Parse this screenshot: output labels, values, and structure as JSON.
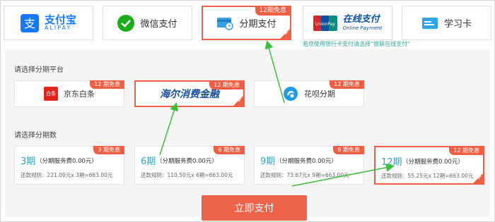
{
  "pay_methods": [
    {
      "id": "alipay",
      "label": "支付宝",
      "sublabel": "ALIPAY",
      "selected": false
    },
    {
      "id": "wechat",
      "label": "微信支付",
      "selected": false
    },
    {
      "id": "installment",
      "label": "分期支付",
      "badge": "12期免息",
      "selected": true
    },
    {
      "id": "unionpay",
      "label": "在线支付",
      "sublabel": "Online Payment",
      "brand": "UnionPay 银联",
      "selected": false
    },
    {
      "id": "studycard",
      "label": "学习卡",
      "selected": false
    }
  ],
  "unionpay_tip": "若您使用银行卡支付请选择“银联在线支付”",
  "platform_section_label": "请选择分期平台",
  "platforms": [
    {
      "id": "jd",
      "label": "京东白条",
      "logo_text": "白条",
      "badge": "12 期免息",
      "selected": false
    },
    {
      "id": "haier",
      "label": "海尔消费金融",
      "badge": "12 期免息",
      "selected": true
    },
    {
      "id": "huabei",
      "label": "花呗分期",
      "badge": "12 期免息",
      "selected": false
    }
  ],
  "installment_section_label": "请选择分期数",
  "installments": [
    {
      "num": "3期",
      "fee": "（分期服务费0.00元）",
      "rule": "还款规则：221.00元x 3期=663.00元",
      "badge": "3 期免息",
      "selected": false
    },
    {
      "num": "6期",
      "fee": "（分期服务费0.00元）",
      "rule": "还款规则：110.50元x 6期=663.00元",
      "badge": "6 期免息",
      "selected": false
    },
    {
      "num": "9期",
      "fee": "（分期服务费0.00元）",
      "rule": "还款规则：73.67元x 9期=663.00元",
      "badge": "9 期免息",
      "selected": false
    },
    {
      "num": "12期",
      "fee": "（分期服务费0.00元）",
      "rule": "还款规则：55.25元x 12期=663.00元",
      "badge": "12 期免息",
      "selected": true
    }
  ],
  "pay_button": "立即支付",
  "colors": {
    "accent": "#ef5f45",
    "teal": "#2aa6c4",
    "arrow": "#3cbf3c",
    "alipay": "#1677ff",
    "wechat": "#1aad19"
  }
}
